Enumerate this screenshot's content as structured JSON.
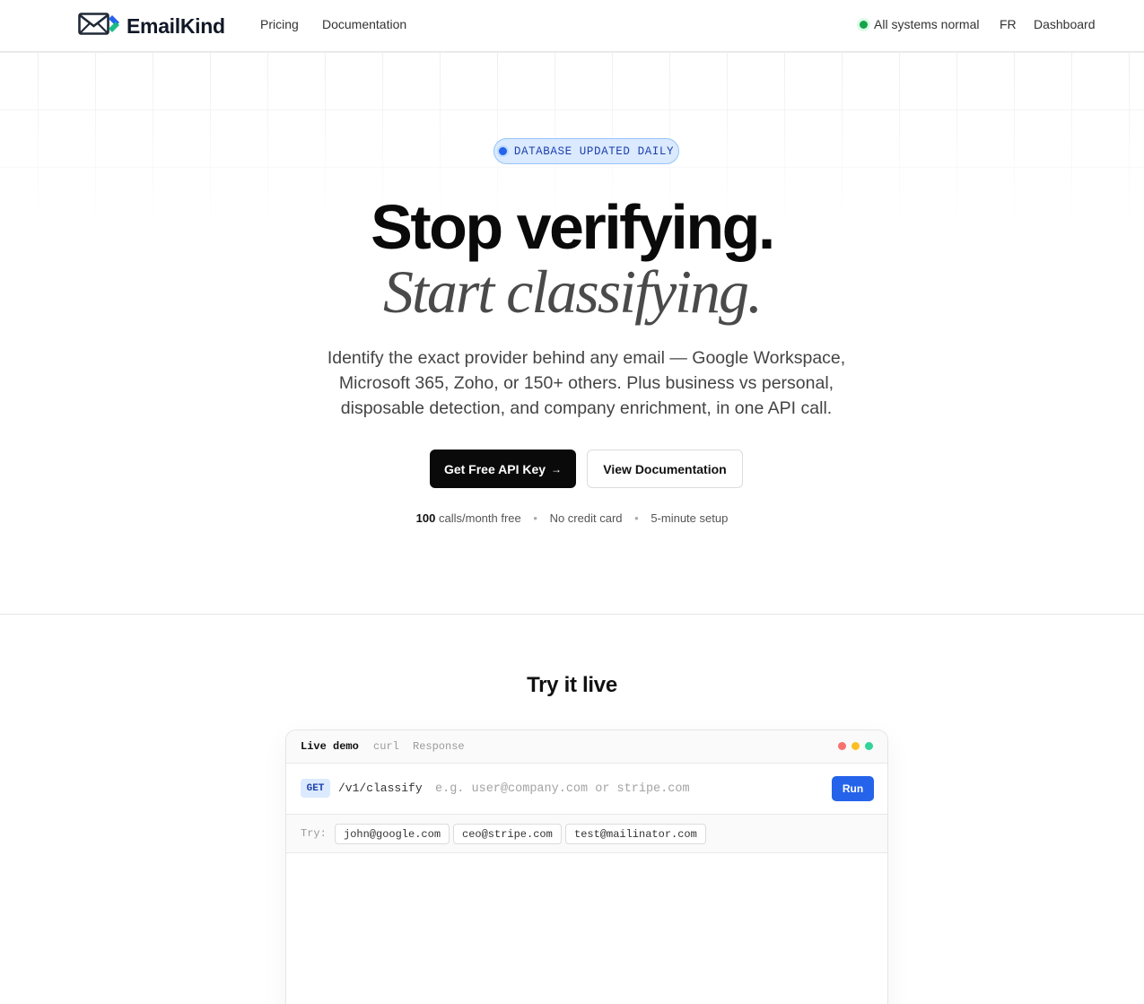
{
  "header": {
    "brand": "EmailKind",
    "nav": [
      {
        "label": "Pricing"
      },
      {
        "label": "Documentation"
      }
    ],
    "status_text": "All systems normal",
    "lang": "FR",
    "dashboard": "Dashboard"
  },
  "hero": {
    "badge": "DATABASE UPDATED DAILY",
    "headline": "Stop verifying.",
    "headline_italic": "Start classifying.",
    "subtitle": "Identify the exact provider behind any email — Google Workspace, Microsoft 365, Zoho, or 150+ others. Plus business vs personal, disposable detection, and company enrichment, in one API call.",
    "primary_cta": "Get Free API Key",
    "primary_cta_arrow": "→",
    "secondary_cta": "View Documentation",
    "perks": {
      "calls_count": "100",
      "calls_text": "calls/month free",
      "no_card": "No credit card",
      "setup": "5-minute setup",
      "separator": "•"
    }
  },
  "demo": {
    "section_title": "Try it live",
    "tabs": [
      {
        "label": "Live demo",
        "active": true
      },
      {
        "label": "curl",
        "active": false
      },
      {
        "label": "Response",
        "active": false
      }
    ],
    "window_dot_colors": [
      "#f87171",
      "#fbbf24",
      "#34d399"
    ],
    "method": "GET",
    "endpoint": "/v1/classify",
    "input_value": "",
    "input_placeholder": "e.g. user@company.com or stripe.com",
    "run_label": "Run",
    "try_label": "Try:",
    "examples": [
      "john@google.com",
      "ceo@stripe.com",
      "test@mailinator.com"
    ]
  },
  "colors": {
    "accent_blue": "#2563eb",
    "status_green": "#16a34a",
    "badge_bg": "#dbeafe",
    "primary_button": "#0a0a0a"
  },
  "icons": {
    "logo": "envelope-logo-icon",
    "status": "status-dot-icon",
    "badge": "badge-dot-icon"
  }
}
